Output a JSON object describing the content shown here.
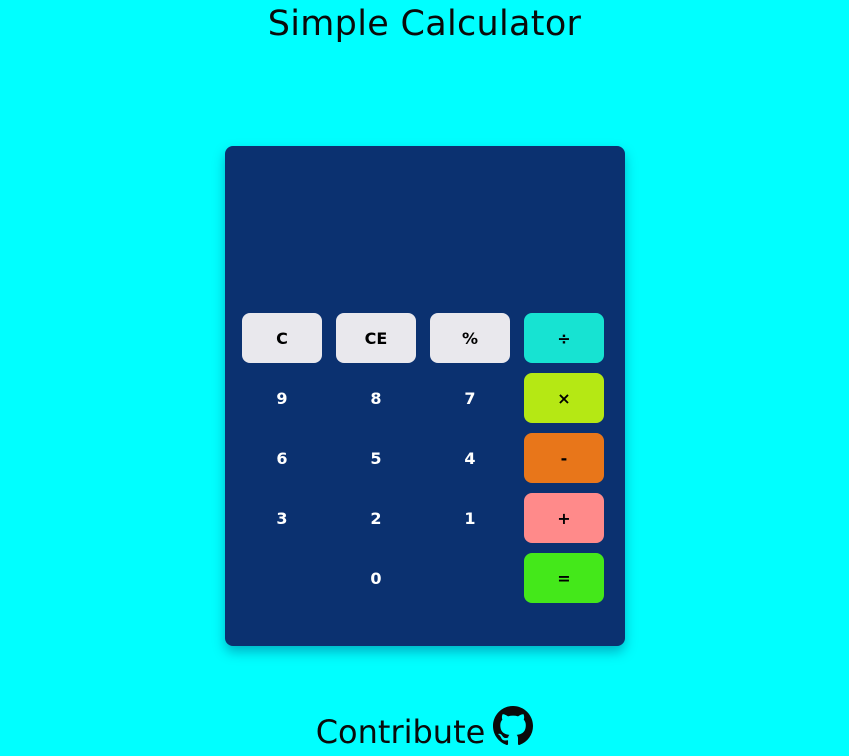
{
  "page": {
    "title": "Simple Calculator",
    "footer_text": "Contribute",
    "background_color": "#00ffff"
  },
  "calculator": {
    "display_value": "",
    "panel_color": "#0b3170",
    "buttons": {
      "clear": "C",
      "clear_entry": "CE",
      "percent": "%",
      "divide": "÷",
      "multiply": "×",
      "subtract": "-",
      "add": "+",
      "equals": "=",
      "digit_9": "9",
      "digit_8": "8",
      "digit_7": "7",
      "digit_6": "6",
      "digit_5": "5",
      "digit_4": "4",
      "digit_3": "3",
      "digit_2": "2",
      "digit_1": "1",
      "digit_0": "0"
    },
    "operator_colors": {
      "divide": "#17e3d2",
      "multiply": "#b5e814",
      "subtract": "#e8761a",
      "add": "#ff8a8a",
      "equals": "#44e81a"
    },
    "light_button_color": "#e9e8ed"
  },
  "icons": {
    "footer_icon": "github-icon"
  }
}
